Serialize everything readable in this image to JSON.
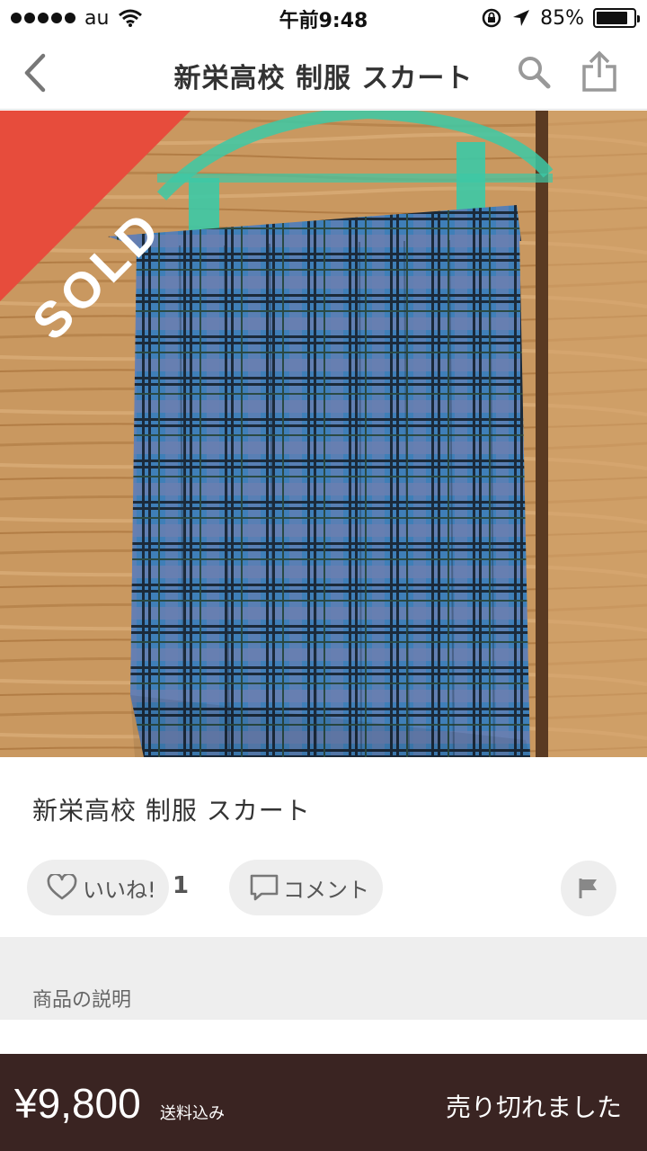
{
  "status_bar": {
    "carrier": "au",
    "time": "午前9:48",
    "battery_percent": "85%",
    "battery_level": 0.85,
    "icons": [
      "signal-dots-icon",
      "wifi-icon",
      "rotation-lock-icon",
      "location-arrow-icon",
      "battery-icon"
    ]
  },
  "nav": {
    "title": "新栄高校 制服 スカート",
    "icons": [
      "back-chevron-icon",
      "search-icon",
      "share-icon"
    ]
  },
  "photo": {
    "sold_label": "SOLD",
    "description_colors": {
      "plaid_base": "#4a7fb0",
      "wood": "#c9955b",
      "hanger": "#3cc9a6"
    }
  },
  "item": {
    "title": "新栄高校 制服 スカート"
  },
  "actions": {
    "like_label": "いいね!",
    "like_count": "1",
    "comment_label": "コメント",
    "icons": [
      "heart-icon",
      "comment-icon",
      "flag-icon"
    ]
  },
  "description": {
    "header": "商品の説明"
  },
  "bottom": {
    "price": "¥9,800",
    "shipping": "送料込み",
    "status": "売り切れました"
  },
  "colors": {
    "sold_red": "#e74c3c",
    "bottom_bar": "#3a2422",
    "pill_bg": "#eeeeee"
  }
}
